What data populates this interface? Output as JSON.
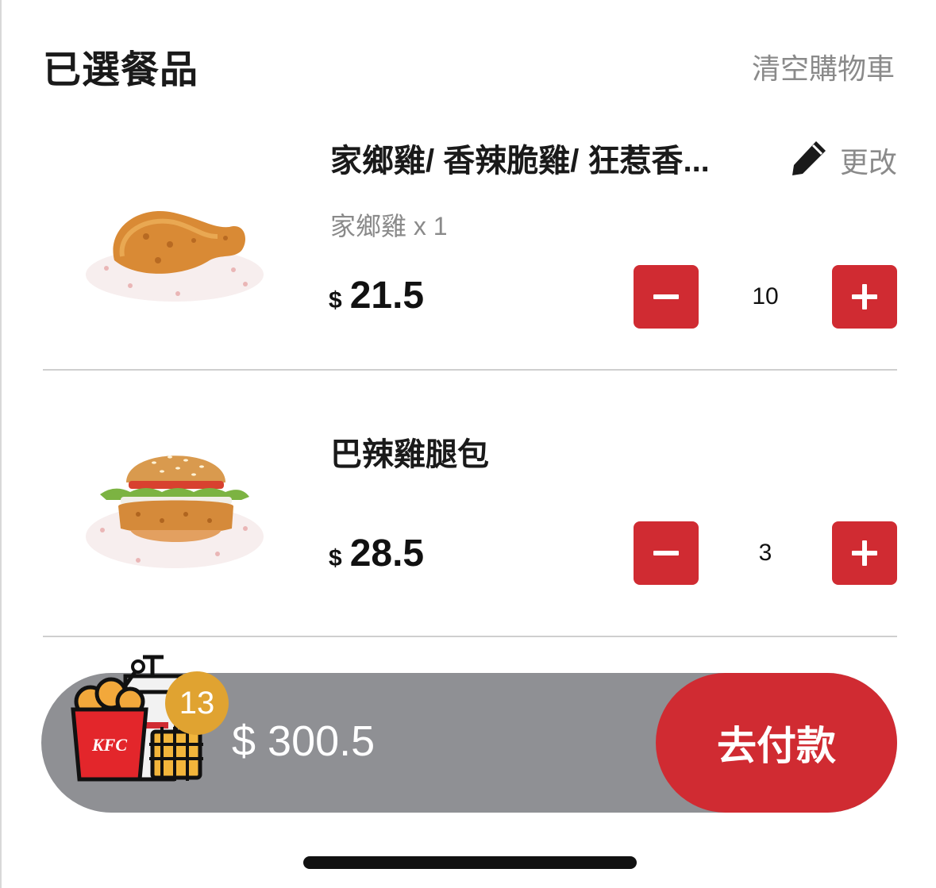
{
  "header": {
    "title": "已選餐品",
    "clear_cart_label": "清空購物車"
  },
  "items": [
    {
      "name": "家鄉雞/ 香辣脆雞/ 狂惹香...",
      "edit_label": "更改",
      "option": "家鄉雞 x 1",
      "currency": "$",
      "price": "21.5",
      "quantity": "10",
      "image": "fried-chicken-drumstick"
    },
    {
      "name": "巴辣雞腿包",
      "currency": "$",
      "price": "28.5",
      "quantity": "3",
      "image": "spicy-chicken-burger"
    }
  ],
  "cart": {
    "item_count": "13",
    "total": "$ 300.5",
    "pay_label": "去付款",
    "bucket_brand": "KFC"
  },
  "colors": {
    "accent": "#d02b32",
    "cart_bar": "#8f9094",
    "badge": "#e0a331",
    "muted_text": "#8a8a8a"
  }
}
